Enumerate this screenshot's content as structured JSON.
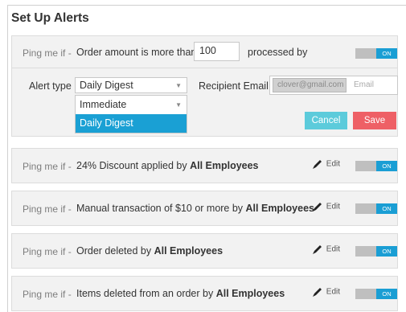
{
  "title": "Set Up Alerts",
  "new_alert": {
    "ping_label": "Ping me if -",
    "condition_text": "Order amount is more than",
    "amount_value": "100",
    "processed_by": "processed by",
    "toggle_label": "ON",
    "alert_type_label": "Alert type",
    "alert_type_selected": "Daily Digest",
    "alert_type_options": [
      "Immediate",
      "Daily Digest"
    ],
    "recipient_label": "Recipient Email",
    "recipient_chip": "clover@gmail.com",
    "email_placeholder": "Email",
    "cancel_label": "Cancel",
    "save_label": "Save"
  },
  "alerts": [
    {
      "ping": "Ping me if -",
      "text": "24% Discount applied by ",
      "who": "All Employees",
      "edit": "Edit",
      "toggle": "ON"
    },
    {
      "ping": "Ping me if -",
      "text": "Manual transaction of $10 or more by ",
      "who": "All Employees",
      "edit": "Edit",
      "toggle": "ON"
    },
    {
      "ping": "Ping me if -",
      "text": "Order deleted by ",
      "who": "All Employees",
      "edit": "Edit",
      "toggle": "ON"
    },
    {
      "ping": "Ping me if -",
      "text": "Items deleted from an order by ",
      "who": "All Employees",
      "edit": "Edit",
      "toggle": "ON"
    }
  ],
  "colors": {
    "accent": "#1a9ed4",
    "cancel": "#5ccbdb",
    "save": "#ee6066"
  }
}
